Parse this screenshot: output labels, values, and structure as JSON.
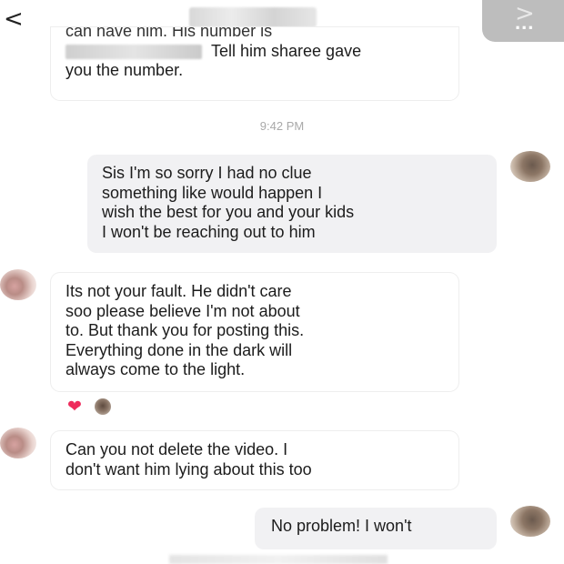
{
  "header": {
    "back_icon": "chevron-left-icon",
    "back_glyph": "<",
    "more_icon": "more-dots-icon",
    "more_glyph": "...",
    "more_arrow": ">"
  },
  "messages": [
    {
      "direction": "incoming",
      "lines": [
        "can have him. His number is",
        "Tell him sharee gave",
        "you the number."
      ]
    },
    {
      "direction": "outgoing",
      "lines": [
        "Sis I'm so sorry I had no clue",
        "something like would happen I",
        "wish the best for you and your kids",
        "I won't be reaching out to him"
      ]
    },
    {
      "direction": "incoming",
      "lines": [
        "Its not your fault. He didn't care",
        "soo please believe I'm not about",
        "to. But thank you for posting this.",
        "Everything done in the dark will",
        "always come to the light."
      ],
      "reactions": [
        "heart-icon",
        "avatar"
      ]
    },
    {
      "direction": "incoming",
      "lines": [
        "Can you not delete the video. I",
        "don't want him lying about this too"
      ]
    },
    {
      "direction": "outgoing",
      "lines": [
        "No problem! I won't"
      ]
    }
  ],
  "timestamp": "9:42 PM",
  "reaction_glyph": "❤"
}
